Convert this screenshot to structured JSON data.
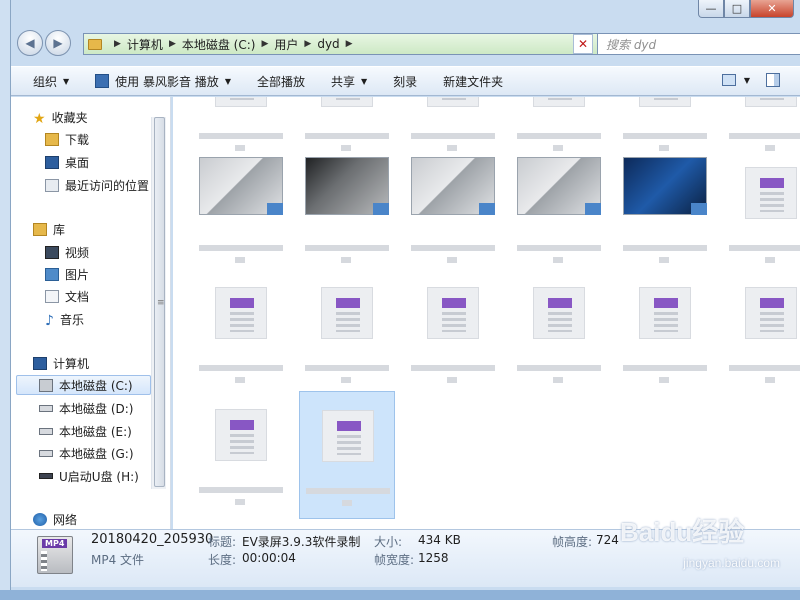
{
  "window": {
    "min": "—",
    "max": "□",
    "close": "✕"
  },
  "address": {
    "crumbs": [
      "计算机",
      "本地磁盘 (C:)",
      "用户",
      "dyd"
    ],
    "search_placeholder": "搜索 dyd"
  },
  "toolbar": {
    "organize": "组织",
    "play_with": "使用 暴风影音 播放",
    "play_all": "全部播放",
    "share": "共享",
    "burn": "刻录",
    "new_folder": "新建文件夹"
  },
  "nav": {
    "favorites": "收藏夹",
    "downloads": "下载",
    "desktop": "桌面",
    "recent": "最近访问的位置",
    "libraries": "库",
    "videos": "视频",
    "pictures": "图片",
    "documents": "文档",
    "music": "音乐",
    "computer": "计算机",
    "drive_c": "本地磁盘 (C:)",
    "drive_d": "本地磁盘 (D:)",
    "drive_e": "本地磁盘 (E:)",
    "drive_g": "本地磁盘 (G:)",
    "usb": "U启动U盘 (H:)",
    "network": "网络"
  },
  "details": {
    "icon_label": "MP4",
    "filename": "20180420_205930",
    "filetype": "MP4 文件",
    "title_label": "标题:",
    "title_value": "EV录屏3.9.3软件录制",
    "length_label": "长度:",
    "length_value": "00:00:04",
    "size_label": "大小:",
    "size_value": "434 KB",
    "width_label": "帧宽度:",
    "width_value": "1258",
    "height_label": "帧高度:",
    "height_value": "724"
  },
  "watermark": {
    "brand": "Baidu经验",
    "url": "jingyan.baidu.com"
  },
  "colors": {
    "accent_purple": "#8857c4",
    "selection": "#cde4fb",
    "address_bg": "#cde9c5"
  }
}
